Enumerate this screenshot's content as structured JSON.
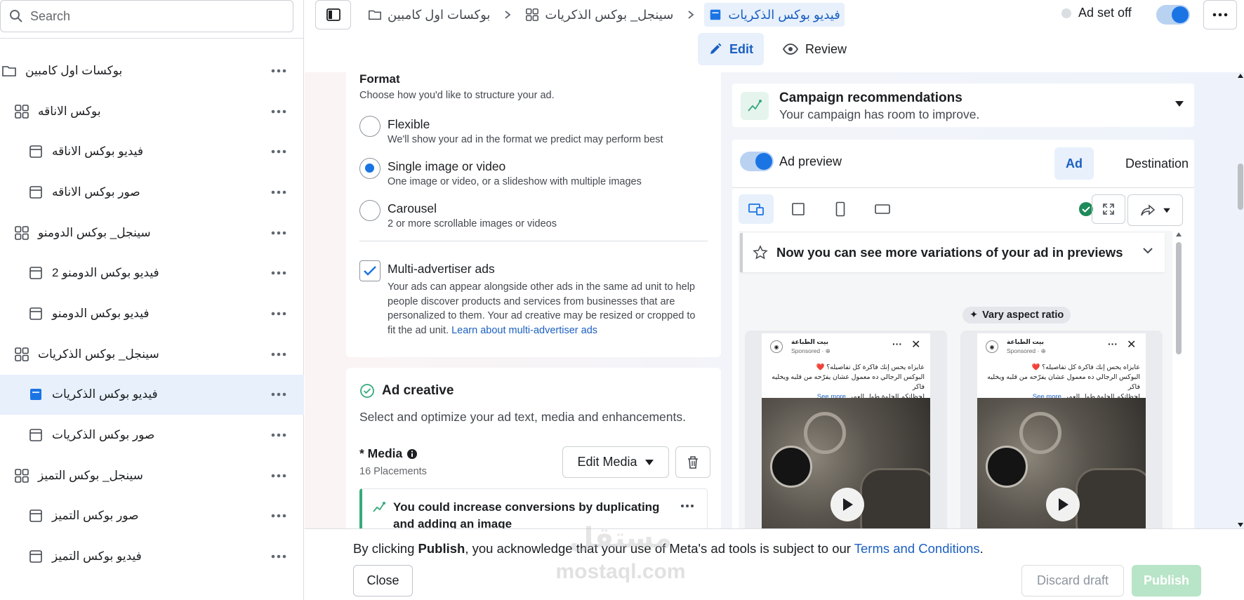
{
  "search": {
    "placeholder": "Search"
  },
  "sidebar": {
    "items": [
      {
        "label": "بوكسات اول كامبين",
        "icon": "folder-icon"
      },
      {
        "label": "بوكس الاناقه",
        "icon": "ad-set-grid-icon"
      },
      {
        "label": "فيديو بوكس الاناقه",
        "icon": "ad-icon"
      },
      {
        "label": "صور بوكس الاناقه",
        "icon": "ad-icon"
      },
      {
        "label": "سينجل_ بوكس الدومنو",
        "icon": "ad-set-grid-icon"
      },
      {
        "label": "2 فيديو بوكس الدومنو",
        "icon": "ad-icon"
      },
      {
        "label": "فيديو بوكس الدومنو",
        "icon": "ad-icon"
      },
      {
        "label": "سينجل_ بوكس الذكريات",
        "icon": "ad-set-grid-icon"
      },
      {
        "label": "فيديو بوكس الذكريات",
        "icon": "ad-icon",
        "selected": true
      },
      {
        "label": "صور بوكس الذكريات",
        "icon": "ad-icon"
      },
      {
        "label": "سينجل_ بوكس التميز",
        "icon": "ad-set-grid-icon"
      },
      {
        "label": "صور بوكس التميز",
        "icon": "ad-icon"
      },
      {
        "label": "فيديو بوكس التميز",
        "icon": "ad-icon"
      }
    ]
  },
  "breadcrumb": {
    "campaign": "بوكسات اول كامبين",
    "adset": "سينجل_ بوكس الذكريات",
    "ad": "فيديو بوكس الذكريات"
  },
  "header": {
    "adset_status": "Ad set off",
    "adset_toggle_on": true
  },
  "modes": {
    "edit": "Edit",
    "review": "Review"
  },
  "format": {
    "title": "Format",
    "subtitle": "Choose how you'd like to structure your ad.",
    "options": [
      {
        "label": "Flexible",
        "desc": "We'll show your ad in the format we predict may perform best",
        "selected": false
      },
      {
        "label": "Single image or video",
        "desc": "One image or video, or a slideshow with multiple images",
        "selected": true
      },
      {
        "label": "Carousel",
        "desc": "2 or more scrollable images or videos",
        "selected": false
      }
    ],
    "multi_label": "Multi-advertiser ads",
    "multi_checked": true,
    "multi_desc": "Your ads can appear alongside other ads in the same ad unit to help people discover products and services from businesses that are personalized to them. Your ad creative may be resized or cropped to fit the ad unit.",
    "multi_link": "Learn about multi-advertiser ads"
  },
  "creative": {
    "title": "Ad creative",
    "subtitle": "Select and optimize your ad text, media and enhancements.",
    "media_label": "* Media",
    "placements": "16 Placements",
    "edit_media": "Edit Media",
    "recommendation": "You could increase conversions by duplicating and adding an image"
  },
  "campaign_rec": {
    "title": "Campaign recommendations",
    "desc": "Your campaign has room to improve."
  },
  "preview": {
    "label": "Ad preview",
    "toggle_on": true,
    "tab_ad": "Ad",
    "tab_destination": "Destination",
    "variations": "Now you can see more variations of your ad in previews",
    "vary_aspect": "Vary aspect ratio",
    "ad_page_name": "بيت الطباعة",
    "ad_sponsored": "Sponsored · ⊕",
    "ad_line1": "عايزاه يحس إنك فاكرة كل تفاصيله؟ ❤️",
    "ad_line2": "البوكس الرجالي ده معمول عشان يفرّحه من قلبه ويخليه فاكر",
    "ad_line3": "لحظاتكم الحلوة طول العمر.",
    "ad_see_more": "See more ..."
  },
  "footer": {
    "legal_prefix": "By clicking ",
    "legal_bold": "Publish",
    "legal_mid": ", you acknowledge that your use of Meta's ad tools is subject to our ",
    "legal_link": "Terms and Conditions",
    "legal_end": ".",
    "close": "Close",
    "discard": "Discard draft",
    "publish": "Publish"
  },
  "watermark": {
    "arabic": "مستقل",
    "latin": "mostaql.com"
  },
  "colors": {
    "accent": "#1b74e4",
    "selected_bg": "#e7f0fb",
    "success": "#36a97d",
    "publish_disabled": "#b8e4c7"
  }
}
